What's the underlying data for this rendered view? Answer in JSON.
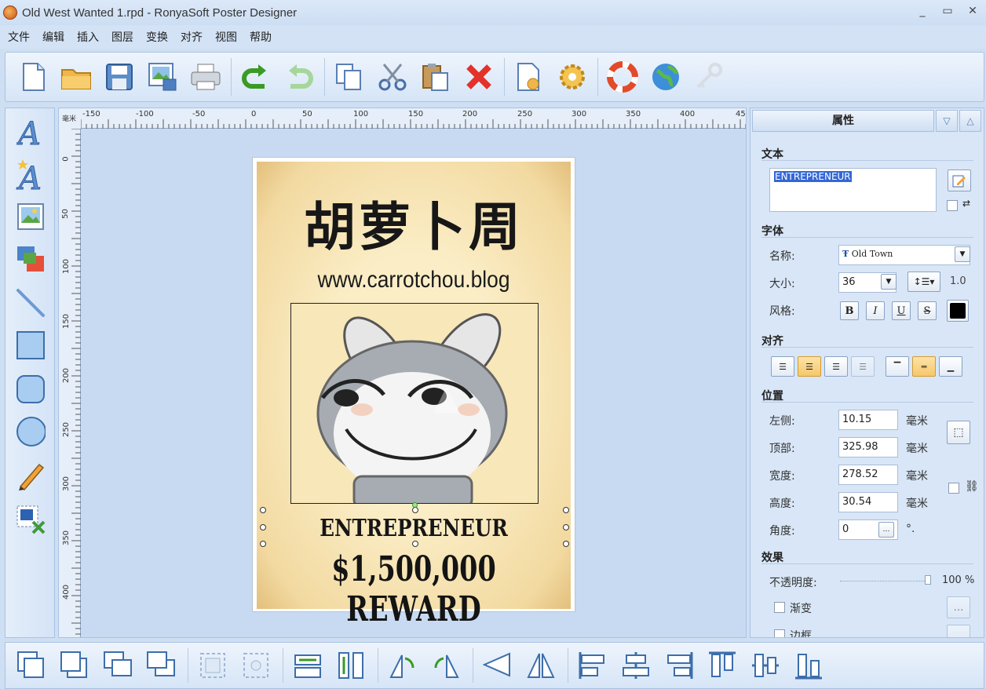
{
  "window": {
    "title": "Old West Wanted 1.rpd - RonyaSoft Poster Designer"
  },
  "menu": [
    "文件",
    "编辑",
    "插入",
    "图层",
    "变换",
    "对齐",
    "视图",
    "帮助"
  ],
  "ruler": {
    "unit": "毫米",
    "h_labels": [
      "-150",
      "-100",
      "-50",
      "0",
      "50",
      "100",
      "150",
      "200",
      "250",
      "300",
      "350",
      "400",
      "45"
    ],
    "v_labels": [
      "0",
      "50",
      "100",
      "150",
      "200",
      "250",
      "300",
      "350",
      "400"
    ]
  },
  "poster": {
    "title": "胡萝卜周",
    "url": "www.carrotchou.blog",
    "name": "ENTREPRENEUR",
    "reward": "$1,500,000 REWARD"
  },
  "props": {
    "header": "属性",
    "text_section": "文本",
    "text_value": "ENTREPRENEUR",
    "font_section": "字体",
    "font_name_label": "名称:",
    "font_name": "Old Town",
    "size_label": "大小:",
    "size_value": "36",
    "line_spacing": "1.0",
    "style_label": "风格:",
    "style_buttons": [
      "B",
      "I",
      "U",
      "S"
    ],
    "align_section": "对齐",
    "position_section": "位置",
    "left_label": "左侧:",
    "left_value": "10.15",
    "top_label": "顶部:",
    "top_value": "325.98",
    "width_label": "宽度:",
    "width_value": "278.52",
    "height_label": "高度:",
    "height_value": "30.54",
    "angle_label": "角度:",
    "angle_value": "0",
    "angle_unit": "°.",
    "unit": "毫米",
    "effects_section": "效果",
    "opacity_label": "不透明度:",
    "opacity_value": "100 %",
    "gradient_label": "渐变",
    "border_label": "边框"
  },
  "colors": {
    "accent": "#cfdff3",
    "text_color": "#000000"
  }
}
